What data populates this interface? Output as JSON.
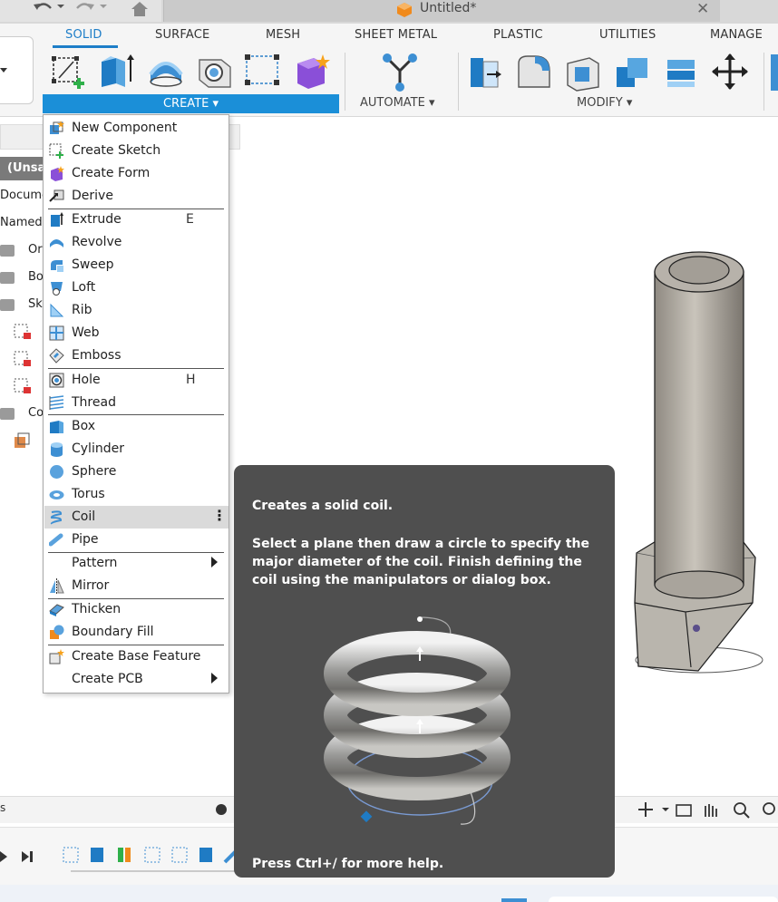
{
  "window": {
    "document_title": "Untitled*"
  },
  "ribbon": {
    "tabs": [
      {
        "label": "SOLID"
      },
      {
        "label": "SURFACE"
      },
      {
        "label": "MESH"
      },
      {
        "label": "SHEET METAL"
      },
      {
        "label": "PLASTIC"
      },
      {
        "label": "UTILITIES"
      },
      {
        "label": "MANAGE"
      }
    ],
    "groups": {
      "create": "CREATE ▾",
      "automate": "AUTOMATE ▾",
      "modify": "MODIFY ▾"
    }
  },
  "browser": {
    "root": "(Unsa",
    "rows": [
      "Docume",
      "Named",
      "Or",
      "Bo",
      "Sk",
      "Co"
    ]
  },
  "create_menu": {
    "items": [
      {
        "label": "New Component",
        "icon": "new-component-icon"
      },
      {
        "label": "Create Sketch",
        "icon": "create-sketch-icon"
      },
      {
        "label": "Create Form",
        "icon": "create-form-icon"
      },
      {
        "label": "Derive",
        "icon": "derive-icon"
      },
      {
        "label": "Extrude",
        "shortcut": "E",
        "icon": "extrude-icon"
      },
      {
        "label": "Revolve",
        "icon": "revolve-icon"
      },
      {
        "label": "Sweep",
        "icon": "sweep-icon"
      },
      {
        "label": "Loft",
        "icon": "loft-icon"
      },
      {
        "label": "Rib",
        "icon": "rib-icon"
      },
      {
        "label": "Web",
        "icon": "web-icon"
      },
      {
        "label": "Emboss",
        "icon": "emboss-icon"
      },
      {
        "label": "Hole",
        "shortcut": "H",
        "icon": "hole-icon"
      },
      {
        "label": "Thread",
        "icon": "thread-icon"
      },
      {
        "label": "Box",
        "icon": "box-icon"
      },
      {
        "label": "Cylinder",
        "icon": "cylinder-icon"
      },
      {
        "label": "Sphere",
        "icon": "sphere-icon"
      },
      {
        "label": "Torus",
        "icon": "torus-icon"
      },
      {
        "label": "Coil",
        "icon": "coil-icon",
        "highlighted": true
      },
      {
        "label": "Pipe",
        "icon": "pipe-icon"
      },
      {
        "label": "Pattern",
        "submenu": true
      },
      {
        "label": "Mirror",
        "icon": "mirror-icon"
      },
      {
        "label": "Thicken",
        "icon": "thicken-icon"
      },
      {
        "label": "Boundary Fill",
        "icon": "boundary-fill-icon"
      },
      {
        "label": "Create Base Feature",
        "icon": "base-feature-icon"
      },
      {
        "label": "Create PCB",
        "submenu": true
      }
    ]
  },
  "tooltip": {
    "title": "Creates a solid coil.",
    "body": "Select a plane then draw a circle to specify the major diameter of the coil. Finish defining the coil using the manipulators or dialog box.",
    "footer": "Press Ctrl+/ for more help."
  },
  "colors": {
    "accent": "#1b8fd8",
    "tooltip_bg": "#4f4f4f",
    "menu_highlight": "#dadada"
  }
}
